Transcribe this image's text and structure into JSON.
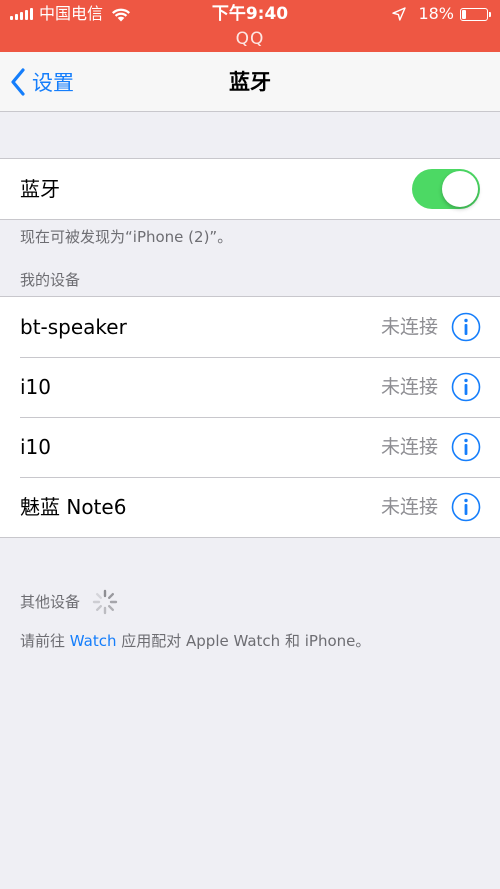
{
  "status_bar": {
    "carrier": "中国电信",
    "time": "下午9:40",
    "battery_percent": "18%",
    "battery_level": 0.18
  },
  "banner": {
    "app_name": "QQ"
  },
  "nav": {
    "back_label": "设置",
    "title": "蓝牙"
  },
  "bluetooth": {
    "label": "蓝牙",
    "enabled": true,
    "discoverable_note": "现在可被发现为“iPhone (2)”。"
  },
  "my_devices": {
    "header": "我的设备",
    "items": [
      {
        "name": "bt-speaker",
        "status": "未连接"
      },
      {
        "name": "i10",
        "status": "未连接"
      },
      {
        "name": "i10",
        "status": "未连接"
      },
      {
        "name": "魅蓝 Note6",
        "status": "未连接"
      }
    ]
  },
  "other_devices": {
    "header": "其他设备",
    "note_prefix": "请前往 ",
    "note_link": "Watch",
    "note_suffix": " 应用配对 Apple Watch 和 iPhone。"
  },
  "colors": {
    "banner": "#ee5743",
    "accent": "#157efb",
    "toggle_on": "#4cd964",
    "background": "#efeff4",
    "secondary_text": "#8e8e93"
  }
}
